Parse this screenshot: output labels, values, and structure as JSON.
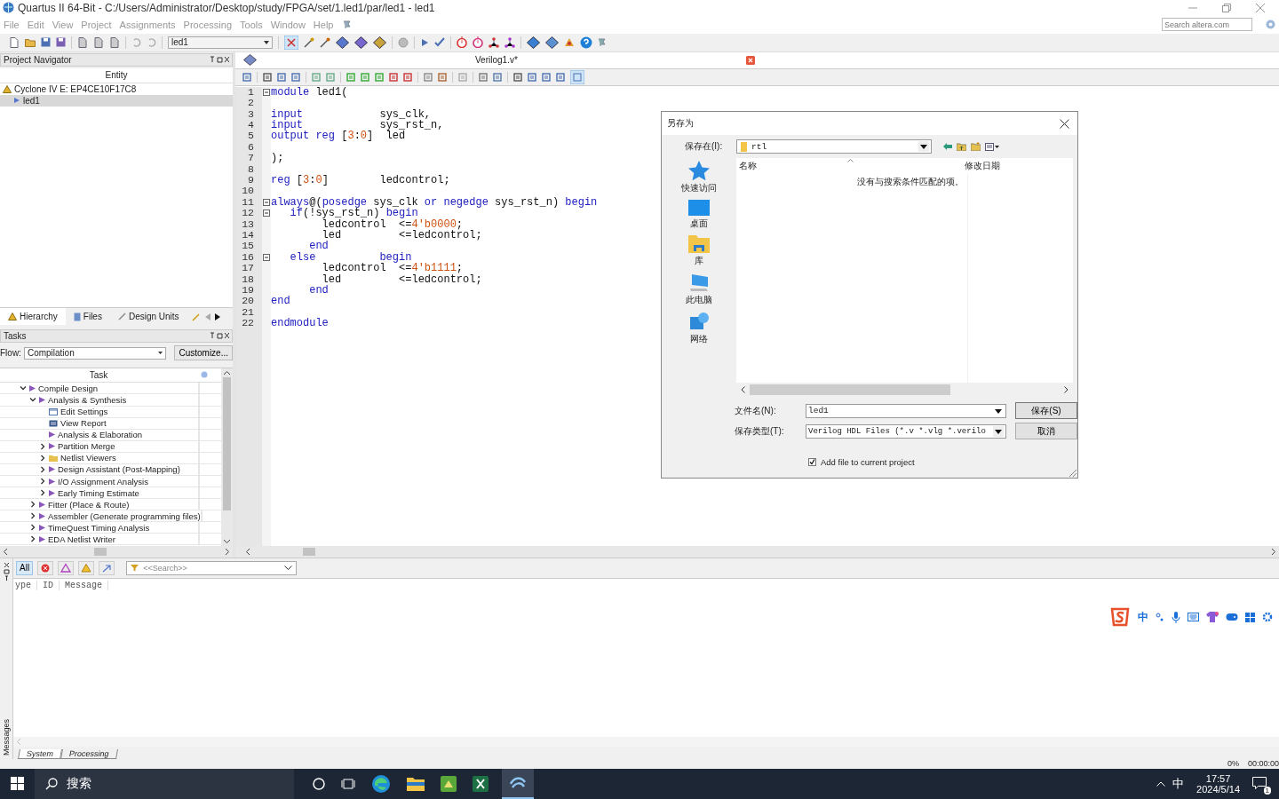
{
  "window": {
    "title": "Quartus II 64-Bit - C:/Users/Administrator/Desktop/study/FPGA/set/1.led1/par/led1 - led1"
  },
  "menu": [
    "File",
    "Edit",
    "View",
    "Project",
    "Assignments",
    "Processing",
    "Tools",
    "Window",
    "Help"
  ],
  "search": {
    "placeholder": "Search altera.com"
  },
  "toolbar": {
    "project_select": "led1"
  },
  "project_navigator": {
    "title": "Project Navigator",
    "column": "Entity",
    "tree": [
      {
        "label": "Cyclone IV E: EP4CE10F17C8",
        "kind": "device",
        "selected": false,
        "children": [
          {
            "label": "led1",
            "kind": "entity",
            "selected": true
          }
        ]
      }
    ],
    "tabs": [
      {
        "label": "Hierarchy",
        "selected": true
      },
      {
        "label": "Files",
        "selected": false
      },
      {
        "label": "Design Units",
        "selected": false
      }
    ]
  },
  "tasks": {
    "title": "Tasks",
    "flow_label": "Flow:",
    "flow": "Compilation",
    "customize": "Customize...",
    "column": "Task",
    "items": [
      {
        "label": "Compile Design",
        "kind": "run",
        "expanded": true,
        "children": [
          {
            "label": "Analysis & Synthesis",
            "kind": "run",
            "expanded": true,
            "children": [
              {
                "label": "Edit Settings",
                "kind": "settings"
              },
              {
                "label": "View Report",
                "kind": "report"
              },
              {
                "label": "Analysis & Elaboration",
                "kind": "run"
              },
              {
                "label": "Partition Merge",
                "kind": "run",
                "expanded": false
              },
              {
                "label": "Netlist Viewers",
                "kind": "folder",
                "expanded": false
              },
              {
                "label": "Design Assistant (Post-Mapping)",
                "kind": "run",
                "expanded": false
              },
              {
                "label": "I/O Assignment Analysis",
                "kind": "run",
                "expanded": false
              },
              {
                "label": "Early Timing Estimate",
                "kind": "run",
                "expanded": false
              }
            ]
          },
          {
            "label": "Fitter (Place & Route)",
            "kind": "run",
            "expanded": false
          },
          {
            "label": "Assembler (Generate programming files)",
            "kind": "run",
            "expanded": false
          },
          {
            "label": "TimeQuest Timing Analysis",
            "kind": "run",
            "expanded": false
          },
          {
            "label": "EDA Netlist Writer",
            "kind": "run",
            "expanded": false
          }
        ]
      }
    ]
  },
  "editor": {
    "tab": "Verilog1.v*",
    "lines": [
      {
        "number": "1",
        "fold": true,
        "segments": [
          {
            "kind": "keyword",
            "text": "module"
          },
          {
            "kind": "plain",
            "text": " led1("
          }
        ]
      },
      {
        "number": "2",
        "fold": false
      },
      {
        "number": "3",
        "fold": false,
        "segments": [
          {
            "kind": "keyword",
            "text": "input"
          },
          {
            "kind": "plain",
            "text": "            sys_clk,"
          }
        ]
      },
      {
        "number": "4",
        "fold": false,
        "segments": [
          {
            "kind": "keyword",
            "text": "input"
          },
          {
            "kind": "plain",
            "text": "            sys_rst_n,"
          }
        ]
      },
      {
        "number": "5",
        "fold": false,
        "segments": [
          {
            "kind": "keyword",
            "text": "output reg"
          },
          {
            "kind": "plain",
            "text": " ["
          },
          {
            "kind": "number",
            "text": "3"
          },
          {
            "kind": "plain",
            "text": ":"
          },
          {
            "kind": "number",
            "text": "0"
          },
          {
            "kind": "plain",
            "text": "]  led"
          }
        ]
      },
      {
        "number": "6",
        "fold": false
      },
      {
        "number": "7",
        "fold": false,
        "segments": [
          {
            "kind": "plain",
            "text": ");"
          }
        ]
      },
      {
        "number": "8",
        "fold": false
      },
      {
        "number": "9",
        "fold": false,
        "segments": [
          {
            "kind": "keyword",
            "text": "reg"
          },
          {
            "kind": "plain",
            "text": " ["
          },
          {
            "kind": "number",
            "text": "3"
          },
          {
            "kind": "plain",
            "text": ":"
          },
          {
            "kind": "number",
            "text": "0"
          },
          {
            "kind": "plain",
            "text": "]        ledcontrol;"
          }
        ]
      },
      {
        "number": "10",
        "fold": false
      },
      {
        "number": "11",
        "fold": true,
        "segments": [
          {
            "kind": "keyword",
            "text": "always"
          },
          {
            "kind": "plain",
            "text": "@("
          },
          {
            "kind": "keyword",
            "text": "posedge"
          },
          {
            "kind": "plain",
            "text": " sys_clk "
          },
          {
            "kind": "keyword",
            "text": "or"
          },
          {
            "kind": "keyword",
            "text": " negedge"
          },
          {
            "kind": "plain",
            "text": " sys_rst_n) "
          },
          {
            "kind": "keyword",
            "text": "begin"
          }
        ]
      },
      {
        "number": "12",
        "fold": true,
        "segments": [
          {
            "kind": "keyword",
            "text": "   if"
          },
          {
            "kind": "plain",
            "text": "(!sys_rst_n) "
          },
          {
            "kind": "keyword",
            "text": "begin"
          }
        ]
      },
      {
        "number": "13",
        "fold": false,
        "segments": [
          {
            "kind": "plain",
            "text": "        ledcontrol  <="
          },
          {
            "kind": "number",
            "text": "4'b0000"
          },
          {
            "kind": "plain",
            "text": ";"
          }
        ]
      },
      {
        "number": "14",
        "fold": false,
        "segments": [
          {
            "kind": "plain",
            "text": "        led         <=ledcontrol;"
          }
        ]
      },
      {
        "number": "15",
        "fold": false,
        "segments": [
          {
            "kind": "keyword",
            "text": "      end"
          }
        ]
      },
      {
        "number": "16",
        "fold": true,
        "segments": [
          {
            "kind": "keyword",
            "text": "   else          begin"
          }
        ]
      },
      {
        "number": "17",
        "fold": false,
        "segments": [
          {
            "kind": "plain",
            "text": "        ledcontrol  <="
          },
          {
            "kind": "number",
            "text": "4'b1111"
          },
          {
            "kind": "plain",
            "text": ";"
          }
        ]
      },
      {
        "number": "18",
        "fold": false,
        "segments": [
          {
            "kind": "plain",
            "text": "        led         <=ledcontrol;"
          }
        ]
      },
      {
        "number": "19",
        "fold": false,
        "segments": [
          {
            "kind": "keyword",
            "text": "      end"
          }
        ]
      },
      {
        "number": "20",
        "fold": false,
        "segments": [
          {
            "kind": "keyword",
            "text": "end"
          }
        ]
      },
      {
        "number": "21",
        "fold": false
      },
      {
        "number": "22",
        "fold": false,
        "segments": [
          {
            "kind": "keyword",
            "text": "endmodule"
          }
        ]
      }
    ]
  },
  "save_dialog": {
    "title": "另存为",
    "save_in_label": "保存在(I):",
    "save_in": "rtl",
    "places": [
      {
        "label": "快速访问",
        "kind": "star"
      },
      {
        "label": "桌面",
        "kind": "desktop"
      },
      {
        "label": "库",
        "kind": "library"
      },
      {
        "label": "此电脑",
        "kind": "computer"
      },
      {
        "label": "网络",
        "kind": "network"
      }
    ],
    "columns": [
      "名称",
      "修改日期"
    ],
    "empty_message": "没有与搜索条件匹配的项。",
    "file_name_label": "文件名(N):",
    "file_name": "led1",
    "file_type_label": "保存类型(T):",
    "file_type": "Verilog HDL Files (*.v *.vlg *.verilo",
    "save_button": "保存(S)",
    "cancel_button": "取消",
    "add_to_project": {
      "label": "Add file to current project",
      "checked": true
    }
  },
  "messages": {
    "side_label": "Messages",
    "filter_all": "All",
    "search_placeholder": "<<Search>>",
    "columns": [
      "ype",
      "ID",
      "Message"
    ],
    "tabs": [
      {
        "label": "System",
        "selected": true
      },
      {
        "label": "Processing",
        "selected": false
      }
    ]
  },
  "status_bar": {
    "progress": "0%",
    "elapsed": "00:00:00"
  },
  "ime_toolbar": {
    "mode": "中"
  },
  "taskbar": {
    "search": "搜索",
    "input_method": "中",
    "time": "17:57",
    "date": "2024/5/14",
    "notifications": "1"
  }
}
